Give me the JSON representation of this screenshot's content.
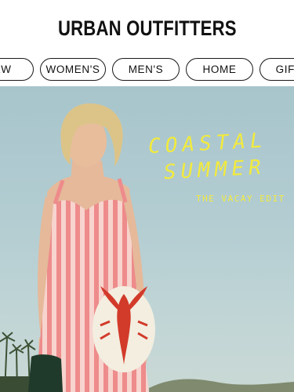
{
  "header": {
    "brand": "URBAN OUTFITTERS"
  },
  "nav": {
    "items": [
      {
        "label": "NEW"
      },
      {
        "label": "WOMEN'S"
      },
      {
        "label": "MEN'S"
      },
      {
        "label": "HOME"
      },
      {
        "label": "GIFTS"
      }
    ]
  },
  "hero": {
    "title_line1": "COASTAL",
    "title_line2": "SUMMER",
    "subtitle": "THE VACAY EDIT",
    "accent_color": "#f2ea3d"
  }
}
